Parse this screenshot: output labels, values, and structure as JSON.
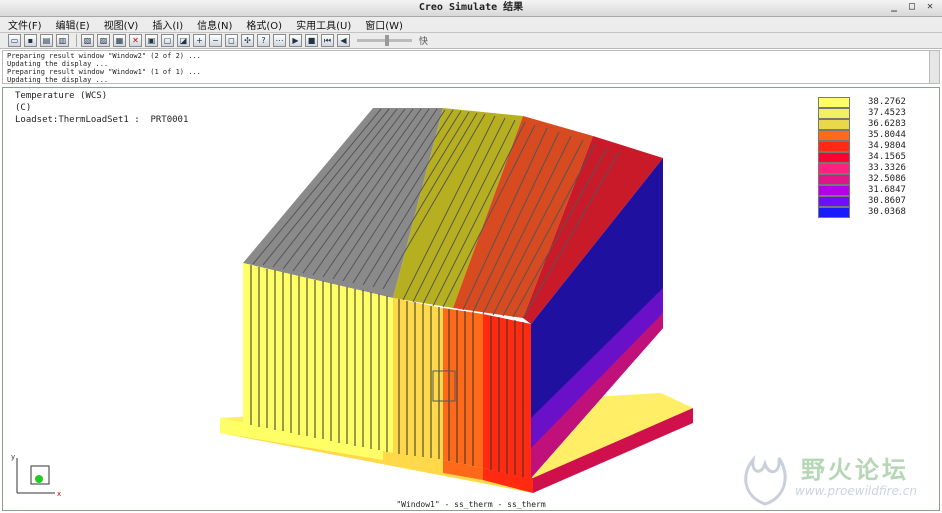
{
  "window": {
    "title": "Creo Simulate 结果",
    "btn_minimize": "_",
    "btn_maximize": "□",
    "btn_close": "✕"
  },
  "menu": [
    "文件(F)",
    "编辑(E)",
    "视图(V)",
    "插入(I)",
    "信息(N)",
    "格式(O)",
    "实用工具(U)",
    "窗口(W)"
  ],
  "toolbar": {
    "icons": [
      "open-icon",
      "save-icon",
      "print-icon",
      "print-preview-icon",
      "copy-icon",
      "copy-view-icon",
      "delete-icon",
      "repaint-icon",
      "result-window-icon",
      "edit-window-icon",
      "zoom-in-icon",
      "zoom-out-icon",
      "zoom-fit-icon",
      "spin-center-icon",
      "query-icon",
      "animate-path-icon",
      "play-icon",
      "stop-icon",
      "first-frame-icon",
      "previous-frame-icon"
    ],
    "speed_label": "快"
  },
  "messages": [
    "Preparing result window \"Window2\" (2 of 2) ...",
    "Updating the display ...",
    "Preparing result window \"Window1\" (1 of 1) ...",
    "Updating the display ..."
  ],
  "viewport": {
    "quantity": "Temperature (WCS)",
    "unit": "(C)",
    "loadset": "Loadset:ThermLoadSet1 :  PRT0001",
    "footer": "\"Window1\" - ss_therm - ss_therm"
  },
  "legend": {
    "values": [
      "38.2762",
      "37.4523",
      "36.6283",
      "35.8044",
      "34.9804",
      "34.1565",
      "33.3326",
      "32.5086",
      "31.6847",
      "30.8607",
      "30.0368"
    ],
    "colors": [
      "#ffff66",
      "#f0f060",
      "#e8d84a",
      "#ff6a1a",
      "#ff2a10",
      "#ff0033",
      "#ff2080",
      "#e0158c",
      "#b400e6",
      "#6a10ff",
      "#1a1aff"
    ]
  },
  "watermark": {
    "text_cn": "野火论坛",
    "url": "www.proewildfire.cn"
  }
}
